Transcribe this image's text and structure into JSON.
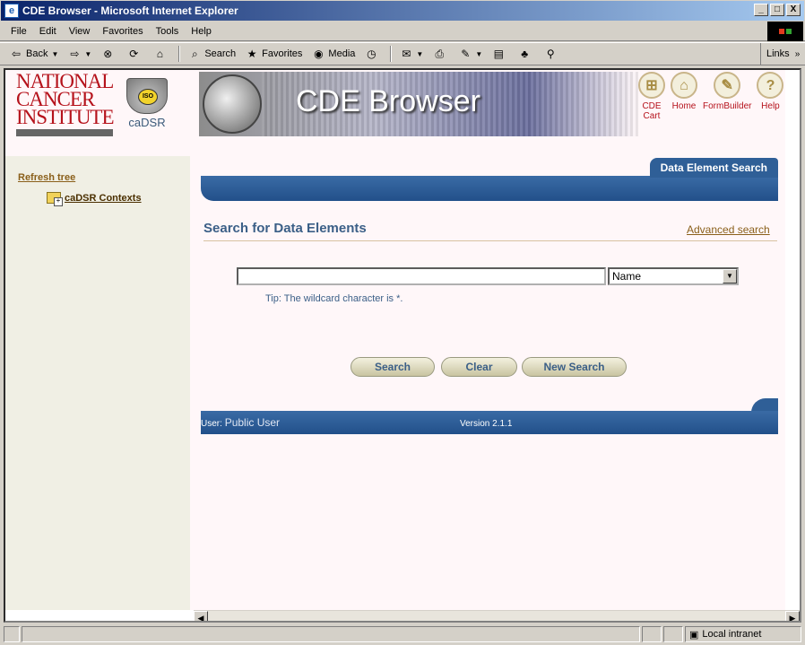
{
  "window": {
    "title": "CDE Browser - Microsoft Internet Explorer",
    "min": "_",
    "max": "□",
    "close": "X"
  },
  "menu": [
    "File",
    "Edit",
    "View",
    "Favorites",
    "Tools",
    "Help"
  ],
  "toolbar": {
    "back": "Back",
    "search": "Search",
    "favorites": "Favorites",
    "media": "Media",
    "links": "Links"
  },
  "header": {
    "nci_logo": [
      "NATIONAL",
      "CANCER",
      "INSTITUTE"
    ],
    "cadsr_label": "caDSR",
    "iso_label": "ISO",
    "banner_title": "CDE Browser",
    "nav": [
      {
        "label": "CDE Cart",
        "icon": "cart-icon"
      },
      {
        "label": "Home",
        "icon": "home-icon"
      },
      {
        "label": "FormBuilder",
        "icon": "formbuilder-icon"
      },
      {
        "label": "Help",
        "icon": "help-icon"
      }
    ]
  },
  "tree": {
    "refresh": "Refresh tree",
    "root": "caDSR Contexts"
  },
  "tab": {
    "label": "Data Element Search"
  },
  "search": {
    "title": "Search for Data Elements",
    "advanced": "Advanced search",
    "query_value": "",
    "field_selected": "Name",
    "tip": "Tip: The wildcard character is *.",
    "buttons": {
      "search": "Search",
      "clear": "Clear",
      "new_search": "New Search"
    }
  },
  "footer": {
    "user_prefix": "User:",
    "user_name": "Public User",
    "version": "Version 2.1.1"
  },
  "status": {
    "zone": "Local intranet"
  }
}
